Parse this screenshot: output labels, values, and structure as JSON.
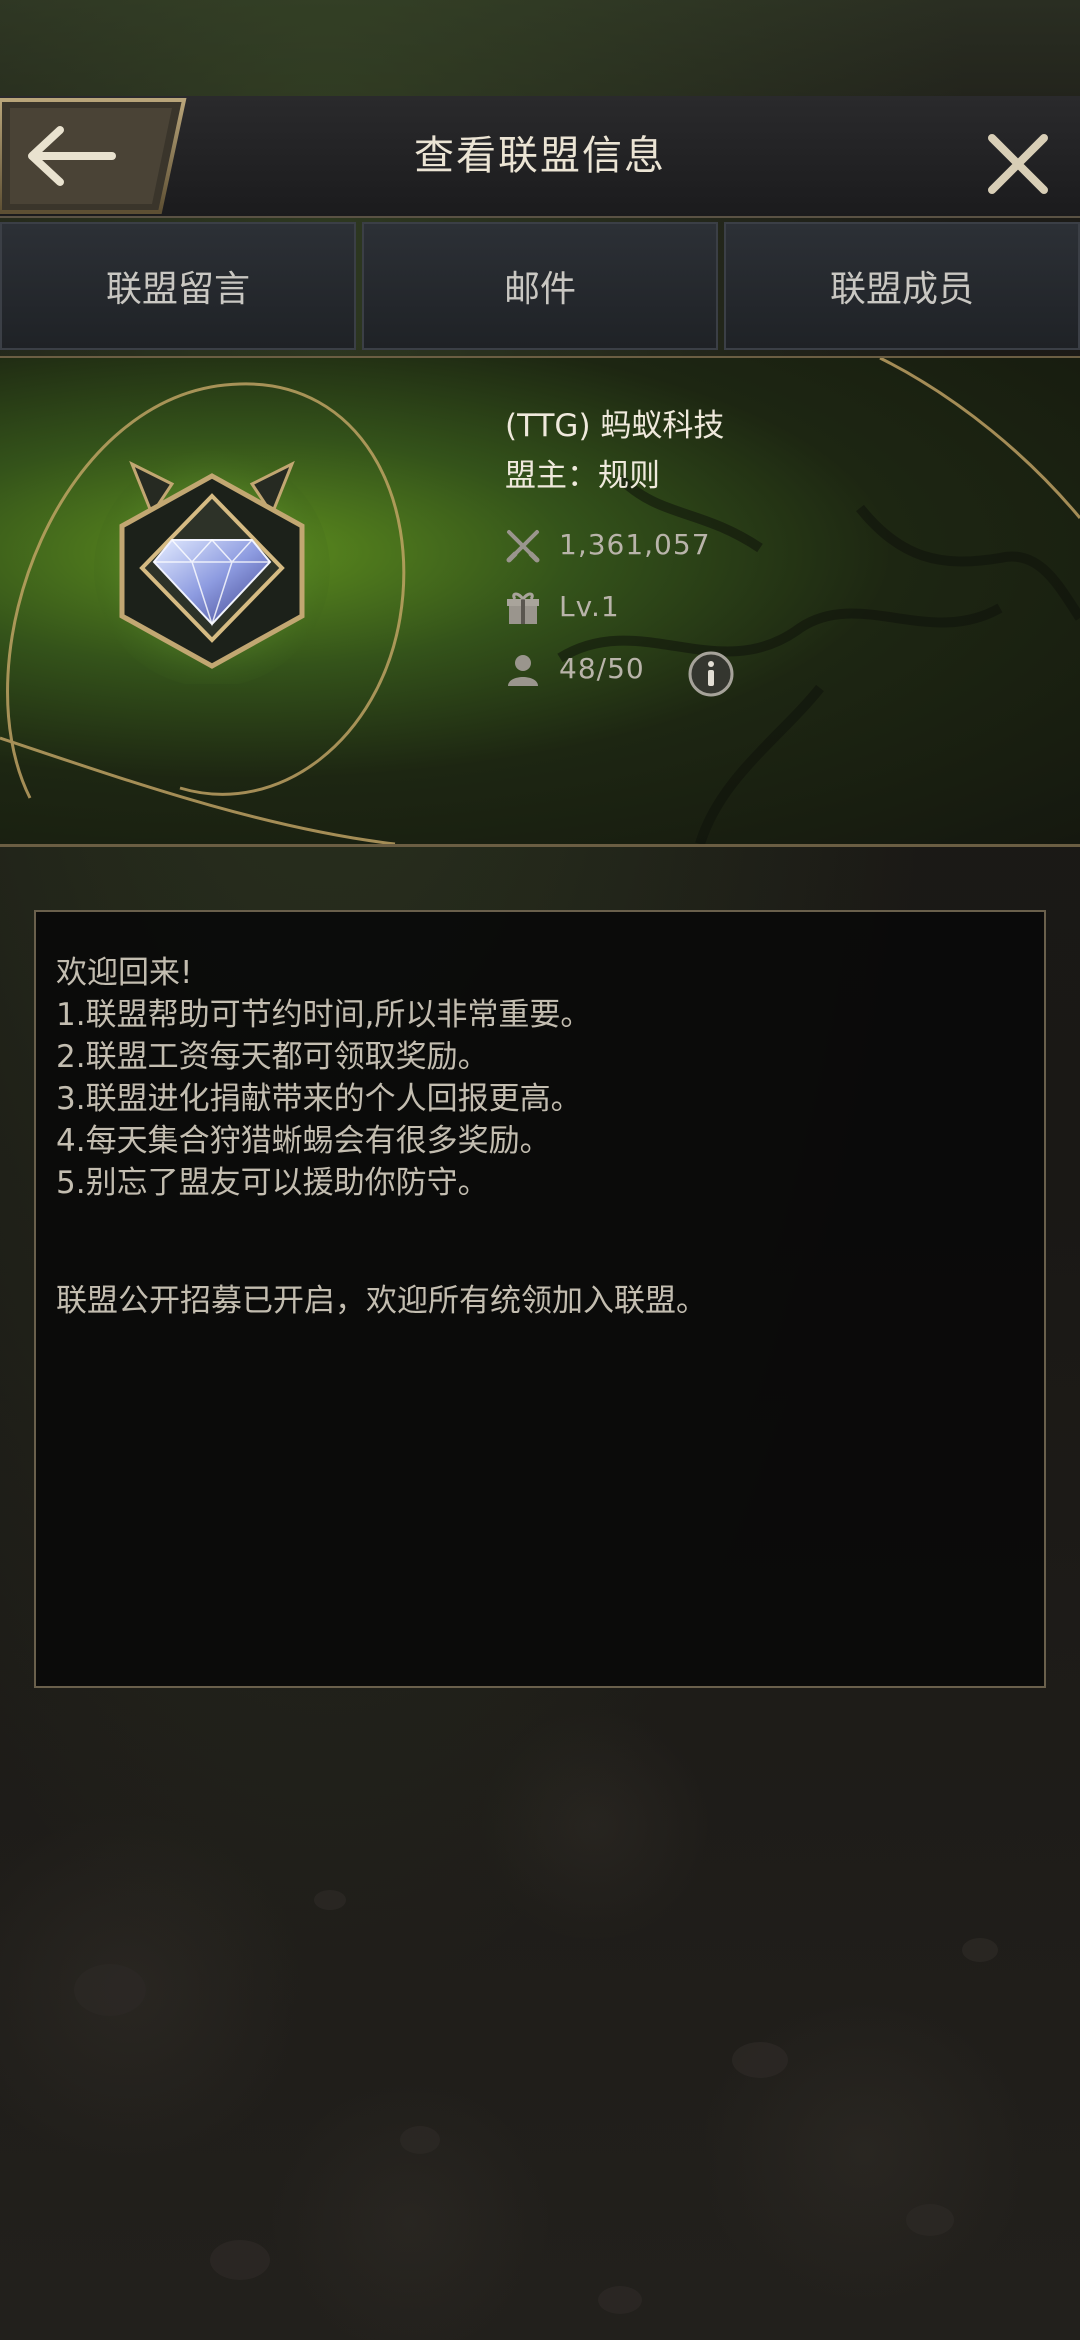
{
  "header": {
    "title": "查看联盟信息",
    "back_icon": "back-arrow-icon",
    "close_icon": "close-icon"
  },
  "tabs": [
    {
      "label": "联盟留言"
    },
    {
      "label": "邮件"
    },
    {
      "label": "联盟成员"
    }
  ],
  "alliance": {
    "name": "(TTG) 蚂蚁科技",
    "leader": "盟主：规则",
    "power": "1,361,057",
    "level": "Lv.1",
    "members": "48/50",
    "emblem_icon": "diamond-emblem-icon"
  },
  "message": {
    "lines": [
      "欢迎回来!",
      "1.联盟帮助可节约时间,所以非常重要。",
      "2.联盟工资每天都可领取奖励。",
      "3.联盟进化捐献带来的个人回报更高。",
      "4.每天集合狩猎蜥蜴会有很多奖励。",
      "5.别忘了盟友可以援助你防守。"
    ],
    "recruit": "联盟公开招募已开启，欢迎所有统领加入联盟。"
  },
  "colors": {
    "accent_gold": "#c8b07a",
    "banner_green": "#5e8f1e",
    "text_light": "#efe9dc"
  }
}
